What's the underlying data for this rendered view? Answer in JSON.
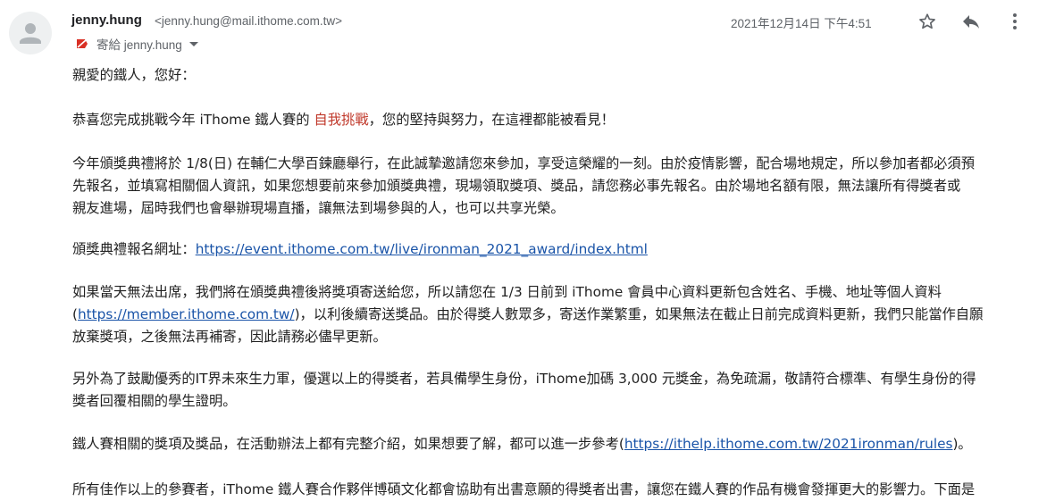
{
  "sender": {
    "name": "jenny.hung",
    "email": "<jenny.hung@mail.ithome.com.tw>",
    "recipient_label": "寄給 jenny.hung"
  },
  "date": "2021年12月14日 下午4:51",
  "icons": {
    "avatar": "person-avatar-icon",
    "label": "important-label-icon",
    "star": "star-icon",
    "reply": "reply-icon",
    "more": "more-vertical-icon"
  },
  "colors": {
    "highlight": "#c0392b",
    "link": "#1a54a8"
  },
  "body": {
    "greeting": "親愛的鐵人，您好：",
    "congrats_pre": "恭喜您完成挑戰今年 iThome 鐵人賽的 ",
    "congrats_highlight": "自我挑戰",
    "congrats_post": "，您的堅持與努力，在這裡都能被看見！",
    "ceremony_lines": [
      "今年頒獎典禮將於 1/8(日) 在輔仁大學百鍊廳舉行，在此誠摯邀請您來參加，享受這榮耀的一刻。由於疫情影響，配合場地規定，所以參加者都必須預",
      "先報名，並填寫相關個人資訊，如果您想要前來參加頒獎典禮，現場領取獎項、獎品，請您務必事先報名。由於場地名額有限，無法讓所有得獎者或",
      "親友進場，屆時我們也會舉辦現場直播，讓無法到場參與的人，也可以共享光榮。"
    ],
    "signup_label": "頒獎典禮報名網址：",
    "signup_link": "https://event.ithome.com.tw/live/ironman_2021_award/index.html",
    "mail_line1": "如果當天無法出席，我們將在頒獎典禮後將獎項寄送給您，所以請您在 1/3 日前到 iThome 會員中心資料更新包含姓名、手機、地址等個人資料",
    "mail_line2_pre": "(",
    "mail_line2_link": "https://member.ithome.com.tw/",
    "mail_line2_post": ")，以利後續寄送獎品。由於得獎人數眾多，寄送作業繁重，如果無法在截止日前完成資料更新，我們只能當作自願",
    "mail_line3": "放棄獎項，之後無法再補寄，因此請務必儘早更新。",
    "student_lines": [
      "另外為了鼓勵優秀的IT界未來生力軍，優選以上的得獎者，若具備學生身份，iThome加碼 3,000 元獎金，為免疏漏，敬請符合標準、有學生身份的得",
      "獎者回覆相關的學生證明。"
    ],
    "rules_pre": "鐵人賽相關的獎項及獎品，在活動辦法上都有完整介紹，如果想要了解，都可以進一步參考(",
    "rules_link": "https://ithelp.ithome.com.tw/2021ironman/rules",
    "rules_post": ")。",
    "publish_line": "所有佳作以上的參賽者，iThome 鐵人賽合作夥伴博碩文化都會協助有出書意願的得獎者出書，讓您在鐵人賽的作品有機會發揮更大的影響力。下面是"
  }
}
